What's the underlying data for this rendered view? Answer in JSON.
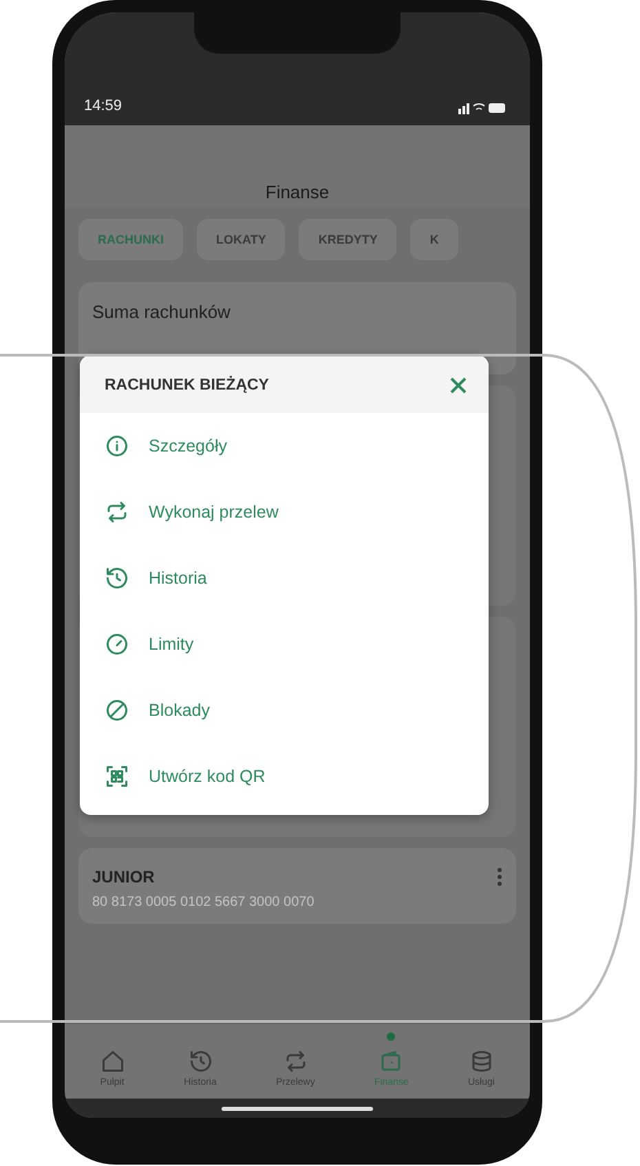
{
  "status_bar": {
    "time": "14:59"
  },
  "header": {
    "title": "Finanse"
  },
  "tabs": [
    {
      "label": "RACHUNKI",
      "selected": true
    },
    {
      "label": "LOKATY",
      "selected": false
    },
    {
      "label": "KREDYTY",
      "selected": false
    },
    {
      "label": "K",
      "selected": false
    }
  ],
  "summary_card": {
    "title": "Suma rachunków"
  },
  "account_card": {
    "name": "JUNIOR",
    "number": "80 8173 0005 0102 5667 3000 0070"
  },
  "menu": {
    "title": "RACHUNEK BIEŻĄCY",
    "items": [
      {
        "kind": "info",
        "label": "Szczegóły"
      },
      {
        "kind": "transfer",
        "label": "Wykonaj przelew"
      },
      {
        "kind": "history",
        "label": "Historia"
      },
      {
        "kind": "limits",
        "label": "Limity"
      },
      {
        "kind": "block",
        "label": "Blokady"
      },
      {
        "kind": "qr",
        "label": "Utwórz kod QR"
      }
    ]
  },
  "bottom_nav": [
    {
      "kind": "home",
      "label": "Pulpit",
      "selected": false
    },
    {
      "kind": "history",
      "label": "Historia",
      "selected": false
    },
    {
      "kind": "transfer",
      "label": "Przelewy",
      "selected": false
    },
    {
      "kind": "wallet",
      "label": "Finanse",
      "selected": true
    },
    {
      "kind": "database",
      "label": "Usługi",
      "selected": false
    }
  ]
}
